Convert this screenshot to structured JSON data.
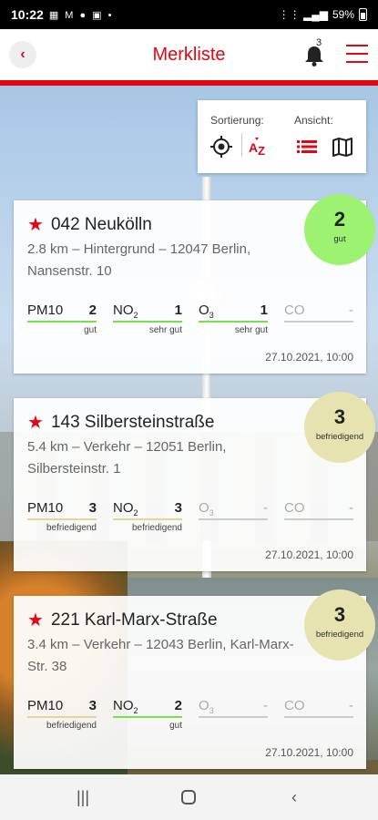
{
  "status": {
    "time": "10:22",
    "battery": "59%"
  },
  "header": {
    "title": "Merkliste",
    "notification_count": "3"
  },
  "sort_panel": {
    "sort_label": "Sortierung:",
    "view_label": "Ansicht:"
  },
  "cards": [
    {
      "title": "042 Neukölln",
      "subtitle": "2.8 km – Hintergrund – 12047 Berlin, Nansenstr. 10",
      "badge_value": "2",
      "badge_label": "gut",
      "metrics": [
        {
          "name": "PM10",
          "value": "2",
          "label": "gut"
        },
        {
          "name": "NO",
          "sub": "2",
          "value": "1",
          "label": "sehr gut"
        },
        {
          "name": "O",
          "sub": "3",
          "value": "1",
          "label": "sehr gut"
        },
        {
          "name": "CO",
          "value": "-",
          "label": ""
        }
      ],
      "date": "27.10.2021, 10:00"
    },
    {
      "title": "143 Silbersteinstraße",
      "subtitle": "5.4 km – Verkehr – 12051 Berlin, Silbersteinstr. 1",
      "badge_value": "3",
      "badge_label": "befriedigend",
      "metrics": [
        {
          "name": "PM10",
          "value": "3",
          "label": "befriedigend"
        },
        {
          "name": "NO",
          "sub": "2",
          "value": "3",
          "label": "befriedigend"
        },
        {
          "name": "O",
          "sub": "3",
          "value": "-",
          "label": ""
        },
        {
          "name": "CO",
          "value": "-",
          "label": ""
        }
      ],
      "date": "27.10.2021, 10:00"
    },
    {
      "title": "221 Karl-Marx-Straße",
      "subtitle": "3.4 km – Verkehr – 12043 Berlin, Karl-Marx-Str. 38",
      "badge_value": "3",
      "badge_label": "befriedigend",
      "metrics": [
        {
          "name": "PM10",
          "value": "3",
          "label": "befriedigend"
        },
        {
          "name": "NO",
          "sub": "2",
          "value": "2",
          "label": "gut"
        },
        {
          "name": "O",
          "sub": "3",
          "value": "-",
          "label": ""
        },
        {
          "name": "CO",
          "value": "-",
          "label": ""
        }
      ],
      "date": "27.10.2021, 10:00"
    }
  ],
  "colors": {
    "accent": "#e30613",
    "gut": "#9df272",
    "befriedigend": "#e6e3b0"
  }
}
